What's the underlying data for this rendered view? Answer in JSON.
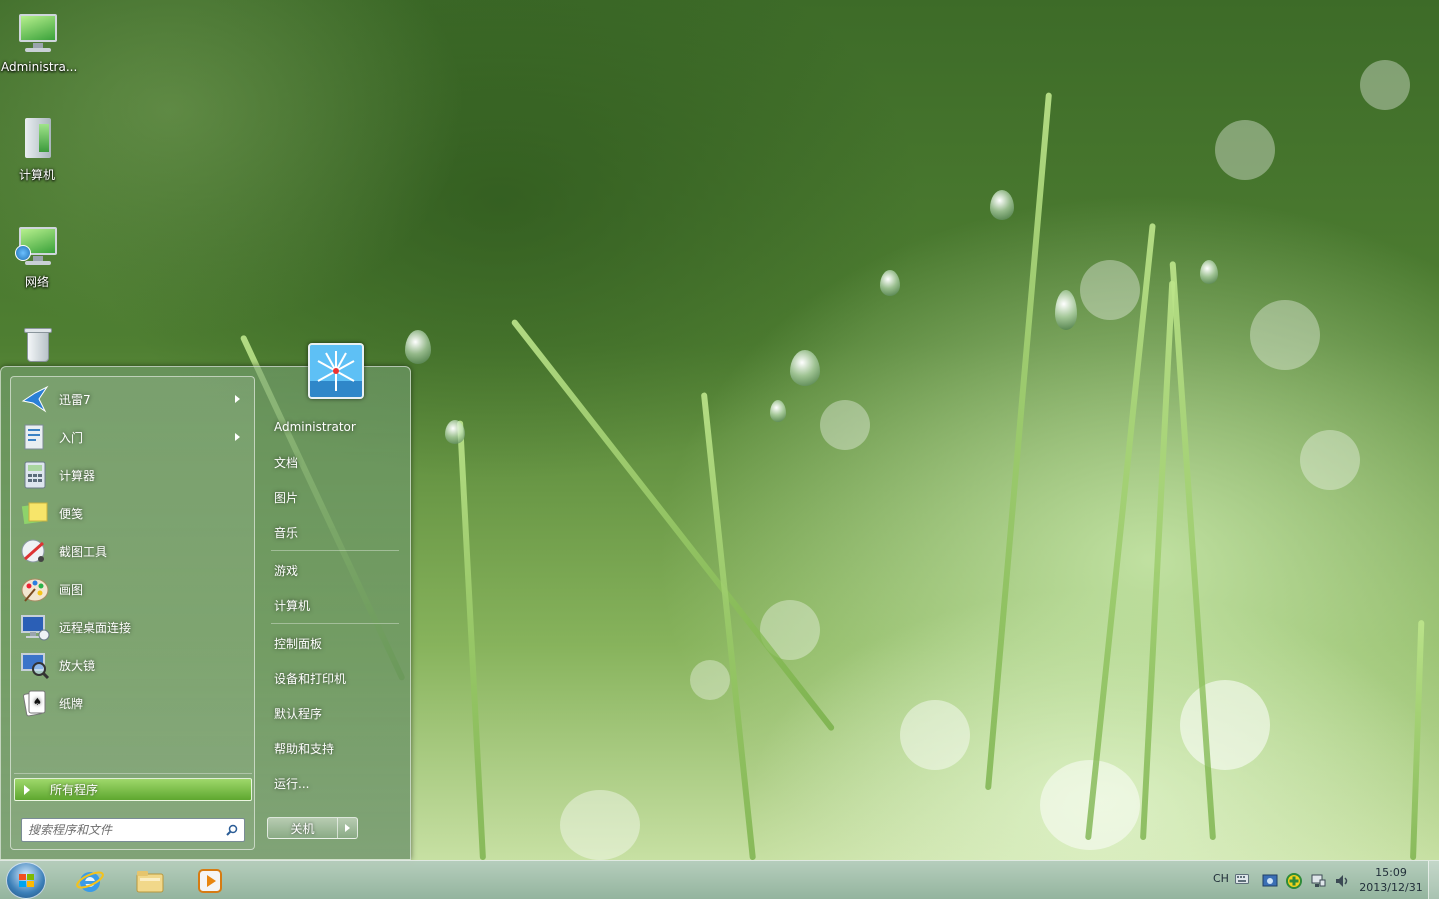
{
  "desktop": {
    "icons": [
      {
        "label": "Administra...",
        "icon": "user-folder-monitor-icon"
      },
      {
        "label": "计算机",
        "icon": "computer-icon"
      },
      {
        "label": "网络",
        "icon": "network-icon"
      },
      {
        "label": "",
        "icon": "recycle-bin-icon"
      }
    ]
  },
  "start_menu": {
    "programs": [
      {
        "label": "迅雷7",
        "icon": "xunlei-icon",
        "has_submenu": true
      },
      {
        "label": "入门",
        "icon": "getting-started-icon",
        "has_submenu": true
      },
      {
        "label": "计算器",
        "icon": "calculator-icon",
        "has_submenu": false
      },
      {
        "label": "便笺",
        "icon": "sticky-notes-icon",
        "has_submenu": false
      },
      {
        "label": "截图工具",
        "icon": "snipping-tool-icon",
        "has_submenu": false
      },
      {
        "label": "画图",
        "icon": "paint-icon",
        "has_submenu": false
      },
      {
        "label": "远程桌面连接",
        "icon": "remote-desktop-icon",
        "has_submenu": false
      },
      {
        "label": "放大镜",
        "icon": "magnifier-icon",
        "has_submenu": false
      },
      {
        "label": "纸牌",
        "icon": "solitaire-icon",
        "has_submenu": false
      }
    ],
    "all_programs_label": "所有程序",
    "search": {
      "placeholder": "搜索程序和文件",
      "value": ""
    },
    "user_name": "Administrator",
    "right_links": [
      {
        "label": "文档"
      },
      {
        "label": "图片"
      },
      {
        "label": "音乐"
      },
      {
        "label": "游戏"
      },
      {
        "label": "计算机"
      },
      {
        "label": "控制面板"
      },
      {
        "label": "设备和打印机"
      },
      {
        "label": "默认程序"
      },
      {
        "label": "帮助和支持"
      },
      {
        "label": "运行..."
      }
    ],
    "shutdown_label": "关机"
  },
  "taskbar": {
    "pinned": [
      {
        "name": "internet-explorer",
        "icon": "internet-explorer-icon"
      },
      {
        "name": "windows-explorer",
        "icon": "folder-icon"
      },
      {
        "name": "media-player",
        "icon": "media-player-icon"
      }
    ],
    "tray": {
      "language": "CH",
      "time": "15:09",
      "date": "2013/12/31"
    }
  }
}
